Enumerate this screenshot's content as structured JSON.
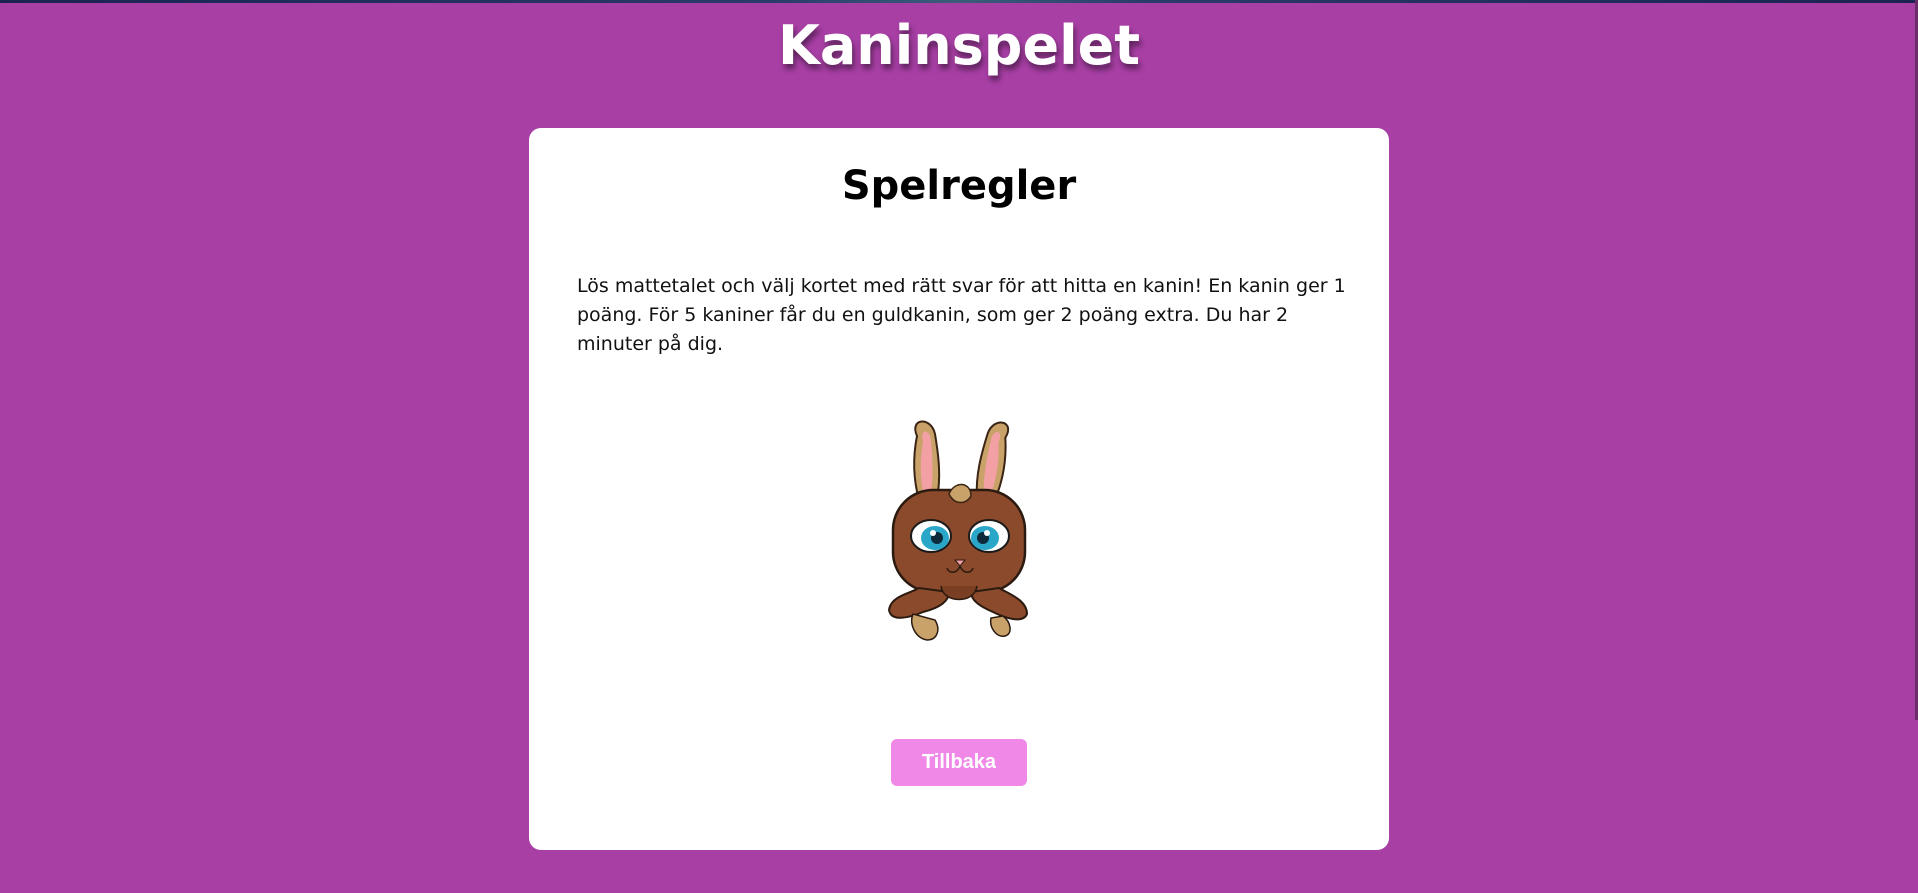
{
  "app": {
    "title": "Kaninspelet"
  },
  "card": {
    "title": "Spelregler",
    "rules_text": "Lös mattetalet och välj kortet med rätt svar för att hitta en kanin! En kanin ger 1 poäng. För 5 kaniner får du en guldkanin, som ger 2 poäng extra. Du har 2 minuter på dig.",
    "back_button_label": "Tillbaka"
  },
  "colors": {
    "background": "#a83fa5",
    "card": "#ffffff",
    "button": "#f088e8",
    "bunny_fur": "#8b4a2b",
    "bunny_ear_inner": "#f2a0a4",
    "bunny_eye": "#2aa6c8"
  },
  "icons": {
    "mascot": "bunny-illustration"
  }
}
